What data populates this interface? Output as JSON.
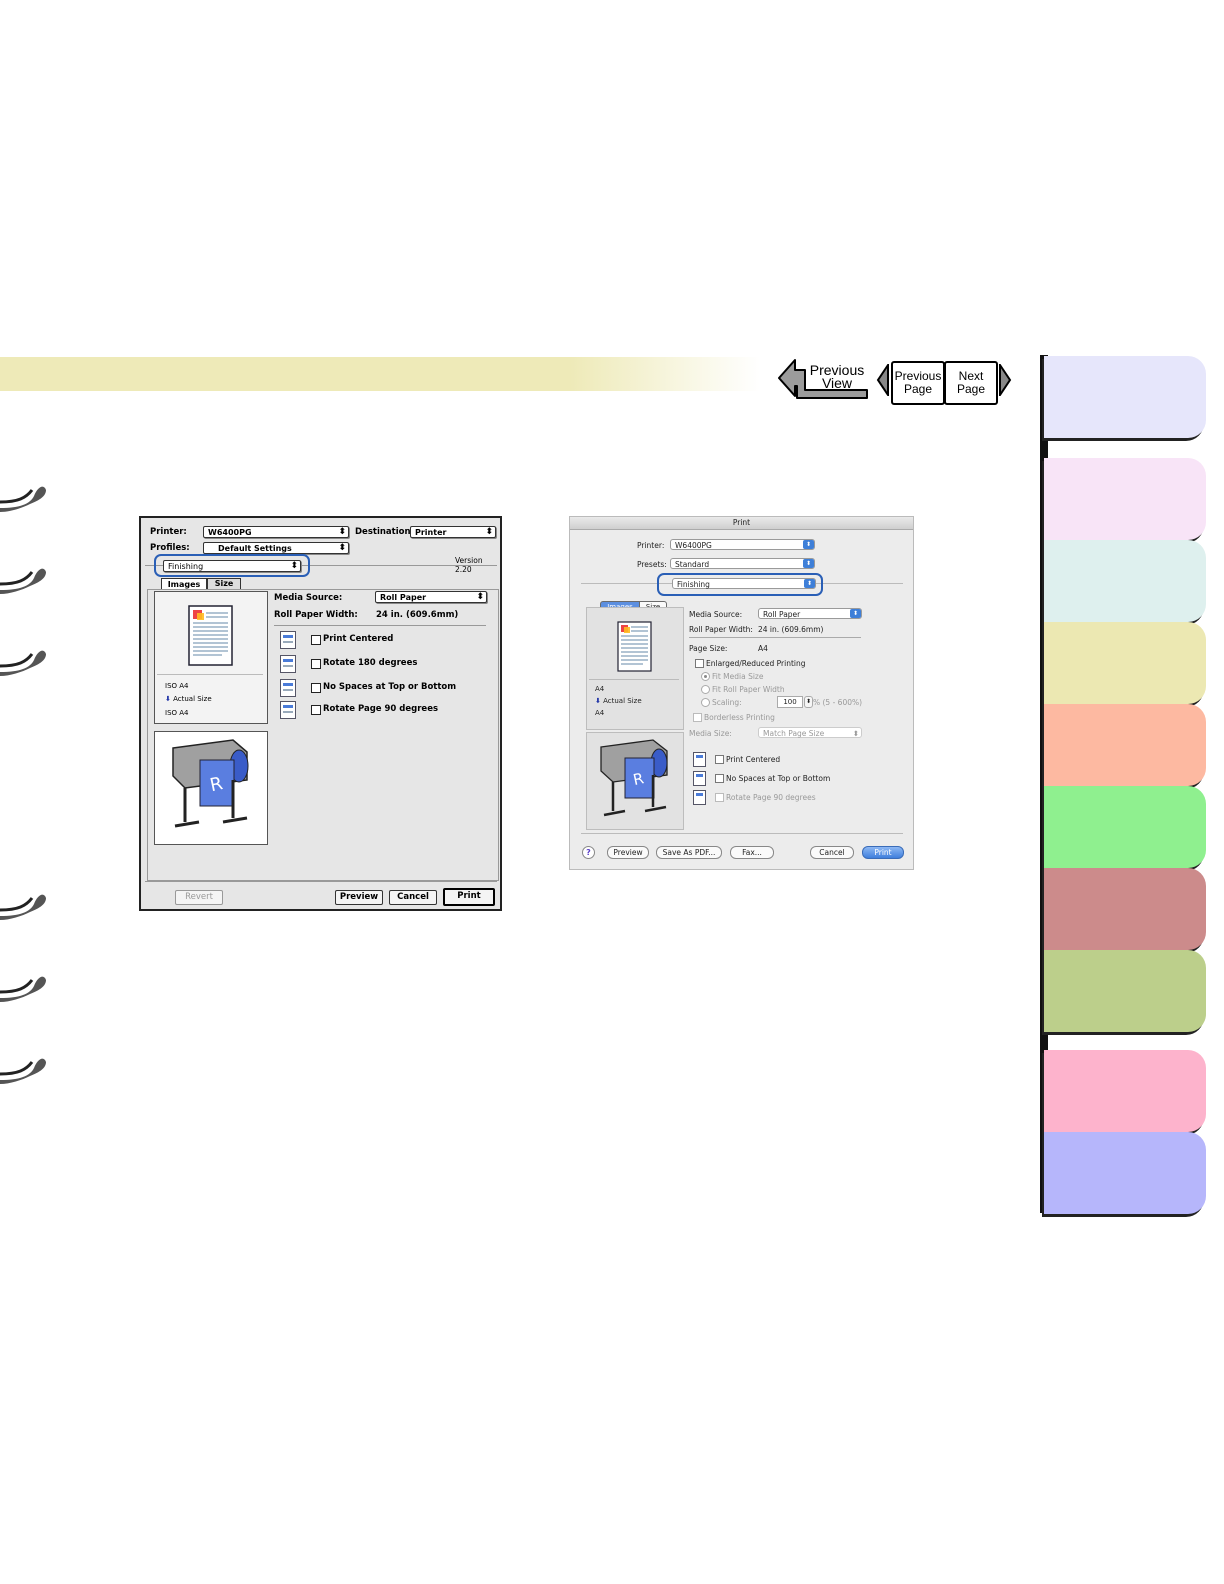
{
  "nav": {
    "previous_view": [
      "Previous",
      "View"
    ],
    "previous_page": [
      "Previous",
      "Page"
    ],
    "next_page": [
      "Next",
      "Page"
    ]
  },
  "sidebar_tabs": [
    {
      "color": "#e6e6fb"
    },
    {
      "color": "#f8e4f7"
    },
    {
      "color": "#def0ee"
    },
    {
      "color": "#ece8b2"
    },
    {
      "color": "#fdb9a1"
    },
    {
      "color": "#8ff08f"
    },
    {
      "color": "#cc8b8b"
    },
    {
      "color": "#bccf8b"
    },
    {
      "color": "#fdb3cc"
    },
    {
      "color": "#b6b6fb"
    }
  ],
  "os9_dialog": {
    "printer_label": "Printer:",
    "printer_value": "W6400PG",
    "destination_label": "Destination:",
    "destination_value": "Printer",
    "profiles_label": "Profiles:",
    "profiles_value": "Default Settings",
    "version": "Version 2.20",
    "panel_value": "Finishing",
    "tabs": [
      "Images",
      "Size"
    ],
    "preview_lines": [
      "ISO A4",
      "Actual Size",
      "ISO A4"
    ],
    "media_source_label": "Media Source:",
    "media_source_value": "Roll Paper",
    "roll_width_label": "Roll Paper Width:",
    "roll_width_value": "24 in. (609.6mm)",
    "options": [
      "Print Centered",
      "Rotate 180 degrees",
      "No Spaces at Top or Bottom",
      "Rotate Page 90 degrees"
    ],
    "buttons": {
      "revert": "Revert",
      "preview": "Preview",
      "cancel": "Cancel",
      "print": "Print"
    }
  },
  "osx_dialog": {
    "title": "Print",
    "printer_label": "Printer:",
    "printer_value": "W6400PG",
    "presets_label": "Presets:",
    "presets_value": "Standard",
    "panel_value": "Finishing",
    "tabs": [
      "Images",
      "Size"
    ],
    "preview_lines": [
      "A4",
      "Actual Size",
      "A4"
    ],
    "media_source_label": "Media Source:",
    "media_source_value": "Roll Paper",
    "roll_width_label": "Roll Paper Width:",
    "roll_width_value": "24 in. (609.6mm)",
    "page_size_label": "Page Size:",
    "page_size_value": "A4",
    "enlarged_label": "Enlarged/Reduced Printing",
    "fit_media": "Fit Media Size",
    "fit_roll": "Fit Roll Paper Width",
    "scaling_label": "Scaling:",
    "scaling_value": "100",
    "scaling_range": "% (5 - 600%)",
    "borderless_label": "Borderless Printing",
    "media_size_label": "Media Size:",
    "media_size_value": "Match Page Size",
    "options": [
      "Print Centered",
      "No Spaces at Top or Bottom",
      "Rotate Page 90 degrees"
    ],
    "buttons": {
      "help": "?",
      "preview": "Preview",
      "save_pdf": "Save As PDF...",
      "fax": "Fax...",
      "cancel": "Cancel",
      "print": "Print"
    }
  },
  "highlight_color": "#2a5fb6"
}
